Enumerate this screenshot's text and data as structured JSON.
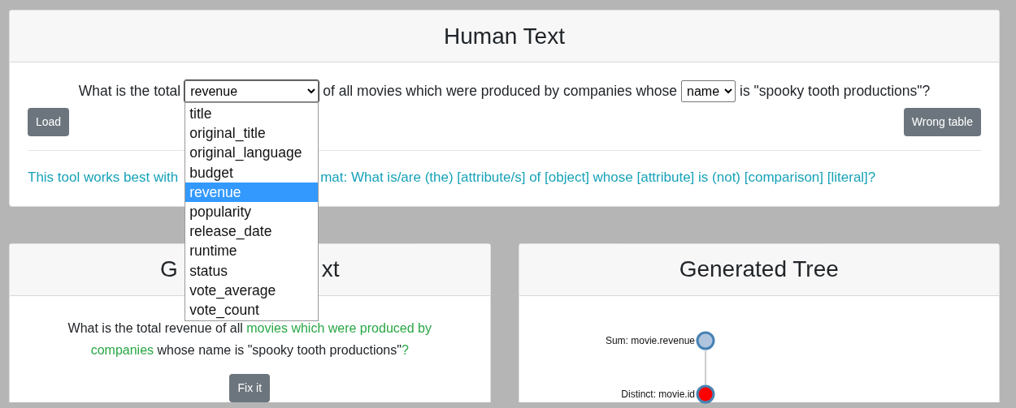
{
  "top_card": {
    "title": "Human Text",
    "question": [
      {
        "kind": "text",
        "text": "What is the total"
      },
      {
        "kind": "select",
        "value": "revenue",
        "expanded": true,
        "options": [
          {
            "label": "title",
            "selected": false
          },
          {
            "label": "original_title",
            "selected": false
          },
          {
            "label": "original_language",
            "selected": false
          },
          {
            "label": "budget",
            "selected": false
          },
          {
            "label": "revenue",
            "selected": true
          },
          {
            "label": "popularity",
            "selected": false
          },
          {
            "label": "release_date",
            "selected": false
          },
          {
            "label": "runtime",
            "selected": false
          },
          {
            "label": "status",
            "selected": false
          },
          {
            "label": "vote_average",
            "selected": false
          },
          {
            "label": "vote_count",
            "selected": false
          }
        ]
      },
      {
        "kind": "text",
        "text": "of all movies which were produced by companies whose"
      },
      {
        "kind": "select",
        "value": "name",
        "expanded": false
      },
      {
        "kind": "text",
        "text": "is \"spooky tooth productions\"?"
      }
    ],
    "buttons": [
      "Load",
      "Wrong table"
    ],
    "hint": [
      "This tool works best with",
      "mat: What is/are (the) [attribute/s] of [object] whose [attribute] is (not) [comparison] [literal]?"
    ]
  },
  "generated_text": {
    "title": [
      "G",
      "xt"
    ],
    "sentence": [
      {
        "text": "What is the total revenue of all ",
        "highlighted": false
      },
      {
        "text": "movies which were produced by companies",
        "highlighted": true
      },
      {
        "text": " whose name is \"spooky tooth productions\"",
        "highlighted": false
      },
      {
        "text": "?",
        "highlighted": true
      }
    ],
    "button": "Fix it"
  },
  "generated_tree": {
    "title": "Generated Tree",
    "nodes": [
      {
        "label": "Sum: movie.revenue",
        "color": "#b0c4de",
        "children": [
          {
            "label": "Distinct: movie.id",
            "color": "#ff0000"
          }
        ]
      }
    ]
  }
}
